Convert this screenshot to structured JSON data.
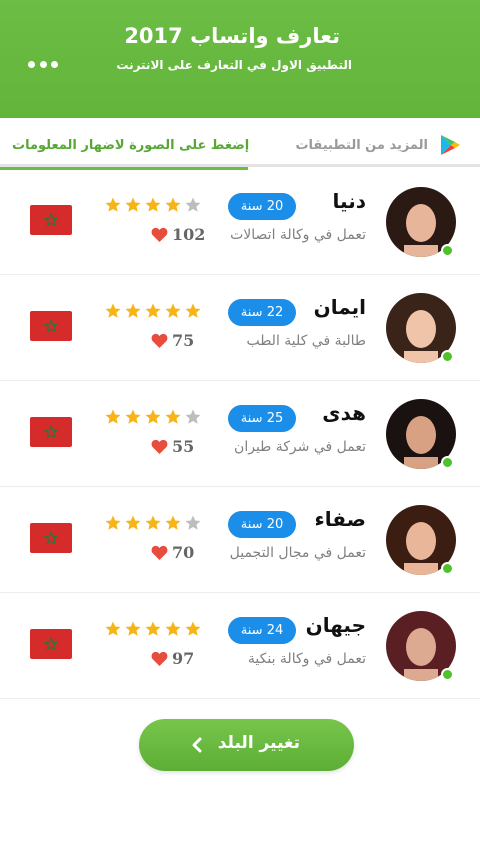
{
  "header": {
    "title": "تعارف واتساب 2017",
    "subtitle": "التطبيق الاول في التعارف على الانترنت",
    "bg_color": "#6cbd45",
    "menu_icon": "more-horizontal-icon"
  },
  "tabs": {
    "more_apps_label": "المزيد من التطبيقات",
    "more_apps_icon": "google-play-icon",
    "info_label": "إضغط على الصورة لاضهار المعلومات",
    "active": "info"
  },
  "profiles": [
    {
      "name": "دنيا",
      "job": "تعمل في وكالة اتصالات",
      "age": "20 سنة",
      "rating": 4,
      "likes": "102",
      "online": true,
      "flag": "morocco-flag"
    },
    {
      "name": "ايمان",
      "job": "طالبة في كلية الطب",
      "age": "22 سنة",
      "rating": 5,
      "likes": "75",
      "online": true,
      "flag": "morocco-flag"
    },
    {
      "name": "هدى",
      "job": "تعمل في شركة طيران",
      "age": "25 سنة",
      "rating": 4,
      "likes": "55",
      "online": true,
      "flag": "morocco-flag"
    },
    {
      "name": "صفاء",
      "job": "تعمل في مجال التجميل",
      "age": "20 سنة",
      "rating": 4,
      "likes": "70",
      "online": true,
      "flag": "morocco-flag"
    },
    {
      "name": "جيهان",
      "job": "تعمل في وكالة بنكية",
      "age": "24 سنة",
      "rating": 5,
      "likes": "97",
      "online": true,
      "flag": "morocco-flag"
    }
  ],
  "colors": {
    "accent": "#6cbd45",
    "age_badge": "#1a8ee8",
    "star_filled": "#f7b416",
    "star_empty": "#bdbdbd",
    "heart": "#e84c3d",
    "online": "#4fc12b",
    "flag_red": "#d62b2b",
    "flag_star": "#1f7a3a"
  },
  "change_country": {
    "label": "تغيير البلد",
    "icon": "chevron-left-icon"
  }
}
